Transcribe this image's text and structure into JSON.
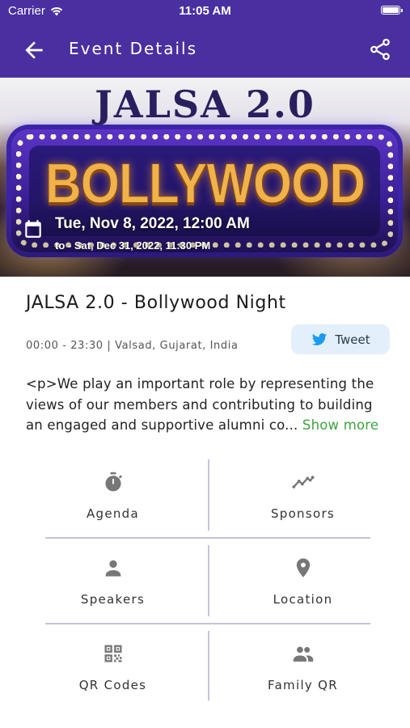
{
  "status_bar": {
    "carrier": "Carrier",
    "time": "11:05 AM"
  },
  "app_bar": {
    "title": "Event Details",
    "back_icon": "arrow-left-icon",
    "share_icon": "share-icon",
    "background_color": "#4a2fa0"
  },
  "banner": {
    "top_text": "JALSA 2.0",
    "main_text": "BOLLYWOOD",
    "start_datetime": "Tue, Nov 8, 2022, 12:00 AM",
    "end_datetime": "to - Sat, Dec 31, 2022, 11:30 PM",
    "calendar_icon": "calendar-icon"
  },
  "event": {
    "title": "JALSA 2.0 - Bollywood Night",
    "meta": "00:00 - 23:30 | Valsad, Gujarat, India",
    "tweet_label": "Tweet",
    "description": "<p>We play an important role by representing the views of our members and contributing to building an engaged and supportive alumni co...",
    "show_more": "Show more",
    "accent_color": "#3da53d"
  },
  "menu": {
    "items": [
      {
        "label": "Agenda",
        "icon": "timer-icon"
      },
      {
        "label": "Sponsors",
        "icon": "trending-icon"
      },
      {
        "label": "Speakers",
        "icon": "person-icon"
      },
      {
        "label": "Location",
        "icon": "location-pin-icon"
      },
      {
        "label": "QR Codes",
        "icon": "qr-code-icon"
      },
      {
        "label": "Family QR",
        "icon": "group-icon"
      }
    ]
  }
}
